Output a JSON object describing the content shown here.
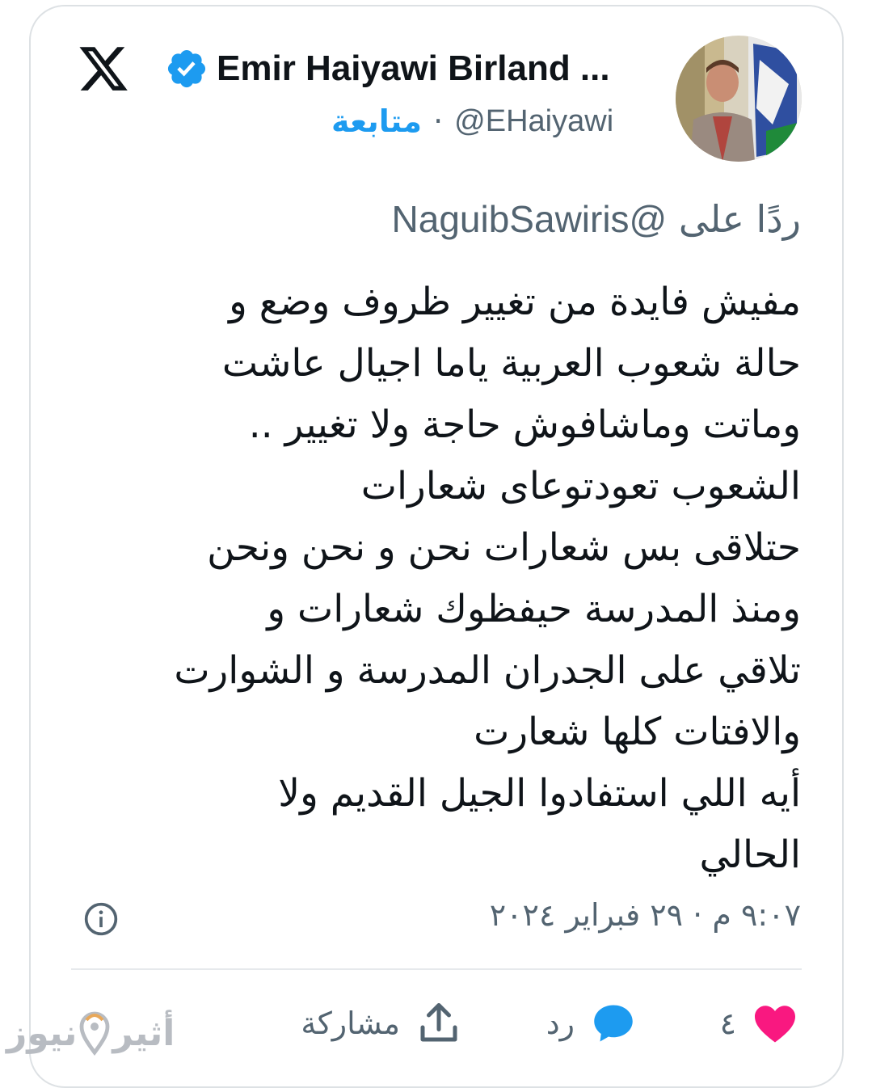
{
  "header": {
    "display_name": "Emir Haiyawi Birland ...",
    "handle": "@EHaiyawi",
    "separator": "·",
    "follow_label": "متابعة"
  },
  "reply_to": {
    "prefix": "ردًا على",
    "mention": "@NaguibSawiris"
  },
  "tweet": {
    "lines": [
      "مفيش فايدة من تغيير ظروف وضع و",
      "حالة شعوب العربية ياما اجيال عاشت",
      "وماتت وماشافوش حاجة ولا تغيير ..",
      "الشعوب تعودتوعاى شعارات",
      "حتلاقى بس شعارات نحن و نحن ونحن",
      "ومنذ المدرسة حيفظوك شعارات و",
      "تلاقي على الجدران المدرسة و الشوارت",
      "والافتات كلها شعارت",
      "أيه اللي استفادوا الجيل القديم ولا",
      "الحالي"
    ]
  },
  "meta": {
    "time": "٩:٠٧ م",
    "separator": "·",
    "date": "٢٩ فبراير ٢٠٢٤"
  },
  "actions": {
    "like_count": "٤",
    "reply_label": "رد",
    "share_label": "مشاركة"
  },
  "watermark": {
    "part1": "أثير",
    "part2": "نيوز"
  },
  "colors": {
    "accent": "#1d9bf0",
    "like": "#f91880",
    "text": "#0f1419",
    "muted": "#536471"
  },
  "icons": {
    "logo": "x-logo-icon",
    "verified": "verified-badge-icon",
    "info": "info-icon",
    "like": "heart-icon",
    "reply": "reply-bubble-icon",
    "share": "share-icon"
  }
}
